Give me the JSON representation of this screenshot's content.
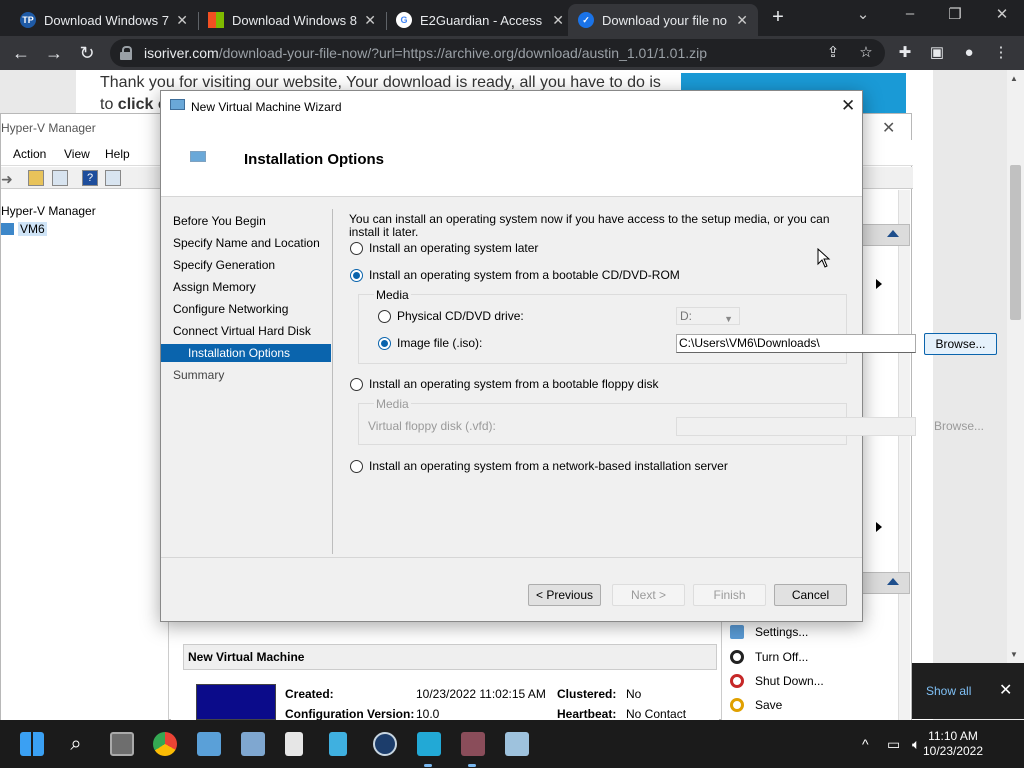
{
  "browser": {
    "tabs": [
      {
        "title": "Download Windows 7",
        "favicon": "tp-favicon",
        "fav_color": "#1e5aa6",
        "fav_text": "TP"
      },
      {
        "title": "Download Windows 8.",
        "favicon": "windows-favicon",
        "fav_color": "#f25022"
      },
      {
        "title": "E2Guardian - Access D",
        "favicon": "google-favicon",
        "fav_color": "#4285f4",
        "fav_text": "G"
      },
      {
        "title": "Download your file no",
        "favicon": "check-favicon",
        "fav_color": "#1a73e8",
        "fav_text": "✓"
      }
    ],
    "url_host": "isoriver.com",
    "url_path": "/download-your-file-now/?url=https://archive.org/download/austin_1.01/1.01.zip"
  },
  "webpage": {
    "line1": "Thank you for visiting our website, Your download is ready, all you have to do is",
    "line2_prefix": "to ",
    "line2_link": "click c"
  },
  "hyperv": {
    "title": "Hyper-V Manager",
    "menu": [
      "Action",
      "View",
      "Help"
    ],
    "tree_root": "Hyper-V Manager",
    "tree_server": "VM6",
    "vm_header": "New Virtual Machine",
    "details": {
      "created_label": "Created:",
      "created_value": "10/23/2022 11:02:15 AM",
      "config_label": "Configuration Version:",
      "config_value": "10.0",
      "clustered_label": "Clustered:",
      "clustered_value": "No",
      "heartbeat_label": "Heartbeat:",
      "heartbeat_value": "No Contact"
    },
    "actions": [
      {
        "label": "Settings...",
        "icon": "settings-icon"
      },
      {
        "label": "Turn Off...",
        "icon": "turn-off-icon"
      },
      {
        "label": "Shut Down...",
        "icon": "shut-down-icon"
      },
      {
        "label": "Save",
        "icon": "save-icon"
      }
    ]
  },
  "wizard": {
    "title": "New Virtual Machine Wizard",
    "header": "Installation Options",
    "steps": [
      "Before You Begin",
      "Specify Name and Location",
      "Specify Generation",
      "Assign Memory",
      "Configure Networking",
      "Connect Virtual Hard Disk",
      "Installation Options",
      "Summary"
    ],
    "intro": "You can install an operating system now if you have access to the setup media, or you can install it later.",
    "option_later": "Install an operating system later",
    "option_cd": "Install an operating system from a bootable CD/DVD-ROM",
    "media_label": "Media",
    "physical_label": "Physical CD/DVD drive:",
    "physical_value": "D:",
    "image_label": "Image file (.iso):",
    "image_value": "C:\\Users\\VM6\\Downloads\\",
    "browse_label": "Browse...",
    "option_floppy": "Install an operating system from a bootable floppy disk",
    "floppy_media_label": "Media",
    "floppy_label": "Virtual floppy disk (.vfd):",
    "floppy_browse_label": "Browse...",
    "option_network": "Install an operating system from a network-based installation server",
    "buttons": {
      "previous": "< Previous",
      "next": "Next >",
      "finish": "Finish",
      "cancel": "Cancel"
    }
  },
  "notification": {
    "show_all": "Show all"
  },
  "taskbar": {
    "time": "11:10 AM",
    "date": "10/23/2022"
  }
}
